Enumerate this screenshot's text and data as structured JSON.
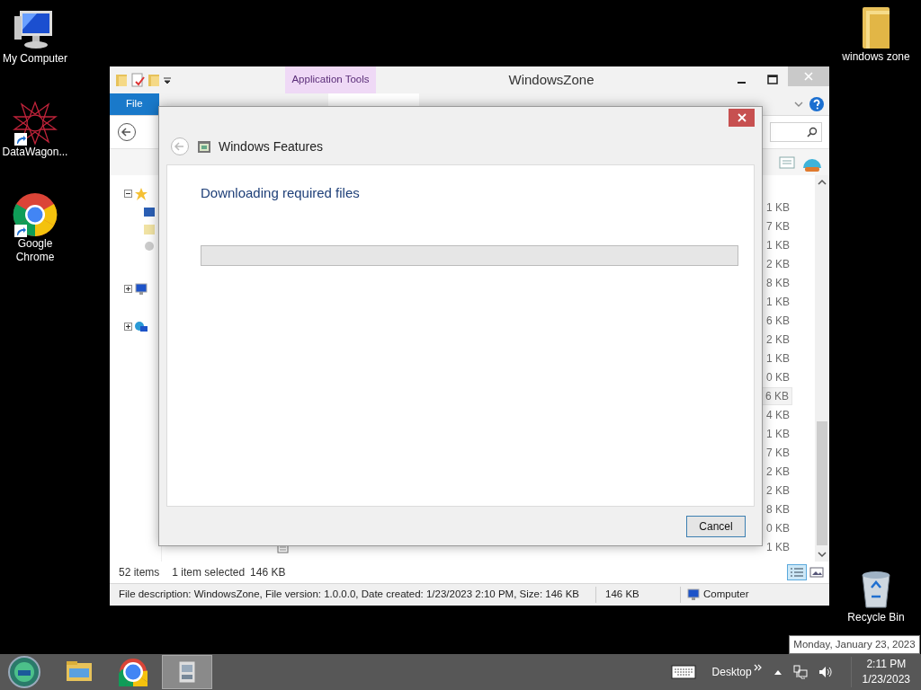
{
  "desktop_icons_left": [
    {
      "label": "My Computer",
      "kind": "computer",
      "shortcut": false
    },
    {
      "label": "DataWagon...",
      "kind": "star",
      "shortcut": true
    },
    {
      "label": "Google Chrome",
      "kind": "chrome",
      "shortcut": true
    }
  ],
  "desktop_icons_right": [
    {
      "label": "windows zone",
      "kind": "folder",
      "shortcut": false
    },
    {
      "label": "Recycle Bin",
      "kind": "recycle",
      "shortcut": false
    }
  ],
  "explorer": {
    "title": "WindowsZone",
    "context_tab": "Application Tools",
    "ribbon_tabs": [
      {
        "label": "File",
        "kind": "file"
      }
    ],
    "tree": [
      {
        "kind": "favorites",
        "expanded": true,
        "children": [
          {
            "kind": "desktop"
          },
          {
            "kind": "downloads"
          },
          {
            "kind": "recent"
          }
        ]
      },
      {
        "kind": "computer",
        "expanded": false
      },
      {
        "kind": "network",
        "expanded": false
      }
    ],
    "files": [
      {
        "size": "1 KB",
        "selected": false
      },
      {
        "size": "7 KB",
        "selected": false
      },
      {
        "size": "1 KB",
        "selected": false
      },
      {
        "size": "2 KB",
        "selected": false
      },
      {
        "size": "8 KB",
        "selected": false
      },
      {
        "size": "1 KB",
        "selected": false
      },
      {
        "size": "6 KB",
        "selected": false
      },
      {
        "size": "2 KB",
        "selected": false
      },
      {
        "size": "1 KB",
        "selected": false
      },
      {
        "size": "0 KB",
        "selected": false
      },
      {
        "size": "6 KB",
        "selected": true
      },
      {
        "size": "4 KB",
        "selected": false
      },
      {
        "size": "1 KB",
        "selected": false
      },
      {
        "size": "7 KB",
        "selected": false
      },
      {
        "size": "2 KB",
        "selected": false
      },
      {
        "size": "2 KB",
        "selected": false
      },
      {
        "size": "8 KB",
        "selected": false
      },
      {
        "size": "0 KB",
        "selected": false
      },
      {
        "kind": "document",
        "size": "1 KB",
        "selected": false
      }
    ],
    "status": {
      "items": "52 items",
      "selection": "1 item selected",
      "selection_size": "146 KB"
    },
    "details": {
      "description": "File description: WindowsZone, File version: 1.0.0.0, Date created: 1/23/2023 2:10 PM, Size: 146 KB",
      "size": "146 KB",
      "location": "Computer"
    }
  },
  "dialog": {
    "title": "Windows Features",
    "heading": "Downloading required files",
    "progress": {
      "level": 0
    },
    "buttons": [
      "Cancel"
    ]
  },
  "taskbar": {
    "apps": [
      {
        "kind": "explorer",
        "active": false
      },
      {
        "kind": "chrome",
        "active": false
      },
      {
        "kind": "app",
        "active": true
      }
    ],
    "toolbar_label": "Desktop",
    "time": "2:11 PM",
    "date": "1/23/2023"
  },
  "tooltip": "Monday, January 23, 2023"
}
